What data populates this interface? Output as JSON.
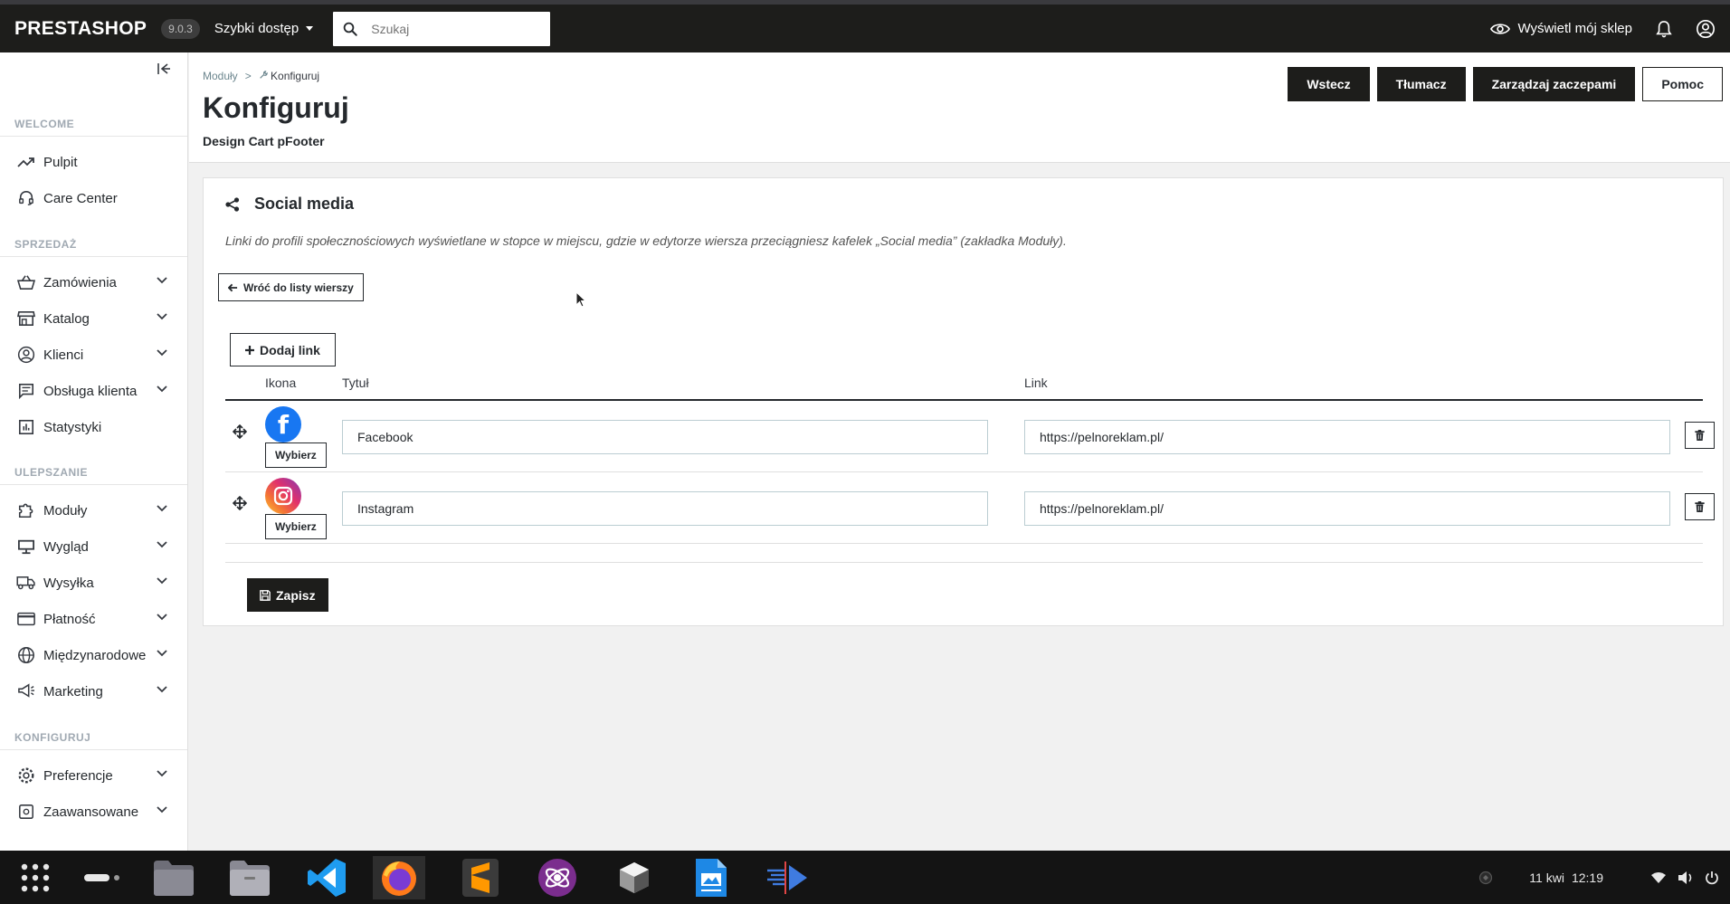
{
  "topbar": {
    "logo": "PRESTASHOP",
    "version": "9.0.3",
    "quick_access": "Szybki dostęp",
    "search_placeholder": "Szukaj",
    "view_shop": "Wyświetl mój sklep"
  },
  "sidebar": {
    "sections": {
      "welcome": "WELCOME",
      "sales": "SPRZEDAŻ",
      "improve": "ULEPSZANIE",
      "configure": "KONFIGURUJ"
    },
    "items": {
      "dashboard": "Pulpit",
      "care_center": "Care Center",
      "orders": "Zamówienia",
      "catalog": "Katalog",
      "customers": "Klienci",
      "customer_service": "Obsługa klienta",
      "stats": "Statystyki",
      "modules": "Moduły",
      "appearance": "Wygląd",
      "shipping": "Wysyłka",
      "payment": "Płatność",
      "international": "Międzynarodowe",
      "marketing": "Marketing",
      "preferences": "Preferencje",
      "advanced": "Zaawansowane"
    }
  },
  "header": {
    "breadcrumb_root": "Moduły",
    "breadcrumb_sep": ">",
    "breadcrumb_current": "Konfiguruj",
    "title": "Konfiguruj",
    "subtitle": "Design Cart pFooter",
    "buttons": {
      "back": "Wstecz",
      "translate": "Tłumacz",
      "hooks": "Zarządzaj zaczepami",
      "help": "Pomoc"
    }
  },
  "card": {
    "title": "Social media",
    "description": "Linki do profili społecznościowych wyświetlane w stopce w miejscu, gdzie w edytorze wiersza przeciągniesz kafelek „Social media” (zakładka Moduły).",
    "back_to_rows": "Wróć do listy wierszy",
    "add_link": "Dodaj link",
    "columns": {
      "icon": "Ikona",
      "title": "Tytuł",
      "link": "Link"
    },
    "choose_label": "Wybierz",
    "rows": [
      {
        "icon": "facebook-icon",
        "title": "Facebook",
        "link": "https://pelnoreklam.pl/"
      },
      {
        "icon": "instagram-icon",
        "title": "Instagram",
        "link": "https://pelnoreklam.pl/"
      }
    ],
    "save": "Zapisz"
  },
  "taskbar": {
    "date": "11 kwi",
    "time": "12:19"
  },
  "colors": {
    "topbar_bg": "#1d1d1b",
    "facebook": "#1877f2",
    "primary_button": "#1d1d1b"
  }
}
